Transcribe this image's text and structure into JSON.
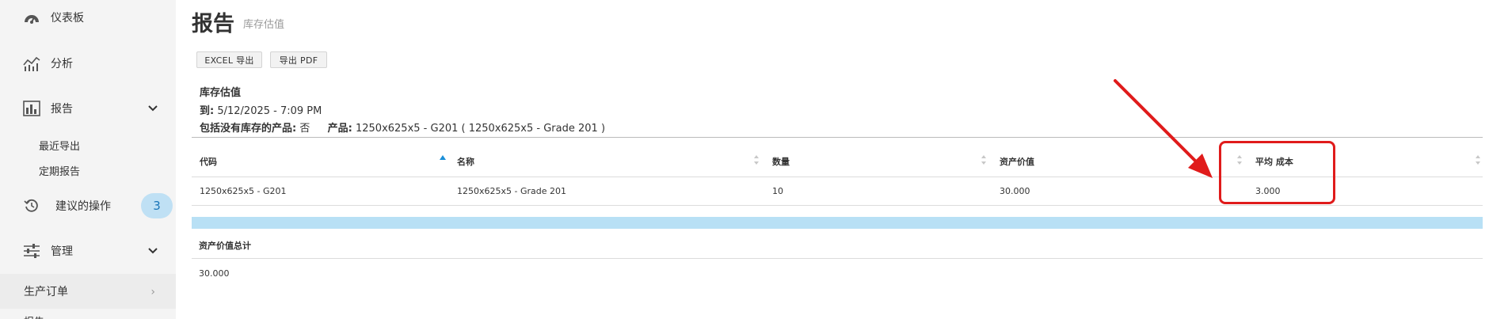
{
  "sidebar": {
    "items": [
      {
        "label": "仪表板"
      },
      {
        "label": "分析"
      },
      {
        "label": "报告"
      },
      {
        "label": "建议的操作"
      },
      {
        "label": "管理"
      }
    ],
    "report_sub": [
      "最近导出",
      "定期报告"
    ],
    "actions_badge": "3",
    "production_label": "生产订单",
    "next_label": "报告"
  },
  "header": {
    "title": "报告",
    "subtitle": "库存估值"
  },
  "toolbar": {
    "excel_label": "EXCEL 导出",
    "pdf_label": "导出 PDF"
  },
  "report_info": {
    "heading": "库存估值",
    "to_label": "到:",
    "to_value": "5/12/2025 - 7:09 PM",
    "include_label": "包括没有库存的产品:",
    "include_value": "否",
    "product_label": "产品:",
    "product_value": "1250x625x5 - G201 ( 1250x625x5 - Grade 201 )"
  },
  "table": {
    "columns": [
      "代码",
      "名称",
      "数量",
      "资产价值",
      "平均 成本"
    ],
    "rows": [
      [
        "1250x625x5 - G201",
        "1250x625x5 - Grade 201",
        "10",
        "30.000",
        "3.000"
      ]
    ]
  },
  "totals": {
    "label": "资产价值总计",
    "value": "30.000"
  },
  "colors": {
    "accent": "#1a75b8",
    "highlight": "#e01b1b",
    "band": "#b8e0f5"
  }
}
